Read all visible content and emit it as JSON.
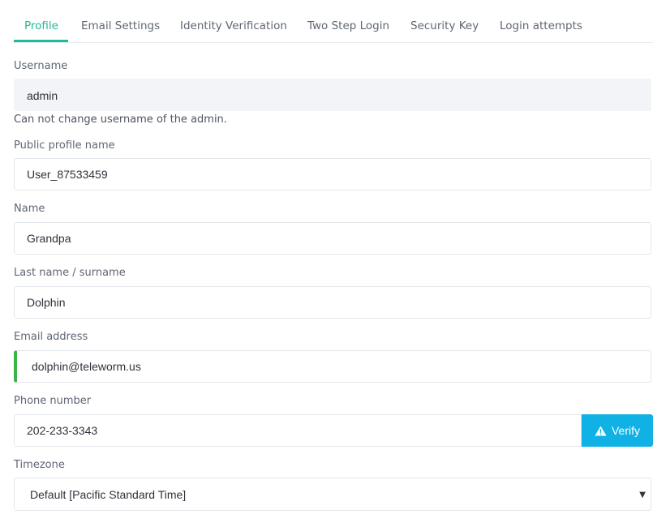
{
  "tabs": [
    {
      "label": "Profile",
      "active": true
    },
    {
      "label": "Email Settings"
    },
    {
      "label": "Identity Verification"
    },
    {
      "label": "Two Step Login"
    },
    {
      "label": "Security Key"
    },
    {
      "label": "Login attempts"
    }
  ],
  "form": {
    "username": {
      "label": "Username",
      "value": "admin",
      "hint": "Can not change username of the admin."
    },
    "public_profile_name": {
      "label": "Public profile name",
      "value": "User_87533459"
    },
    "name": {
      "label": "Name",
      "value": "Grandpa"
    },
    "last_name": {
      "label": "Last name / surname",
      "value": "Dolphin"
    },
    "email": {
      "label": "Email address",
      "value": "dolphin@teleworm.us",
      "status_color": "#3db44a"
    },
    "phone": {
      "label": "Phone number",
      "value": "202-233-3343",
      "verify_label": "Verify",
      "verify_icon": "warning-icon",
      "verify_color": "#10b1e4"
    },
    "timezone": {
      "label": "Timezone",
      "selected": "Default [Pacific Standard Time]"
    }
  },
  "colors": {
    "accent": "#1fbb9a"
  }
}
